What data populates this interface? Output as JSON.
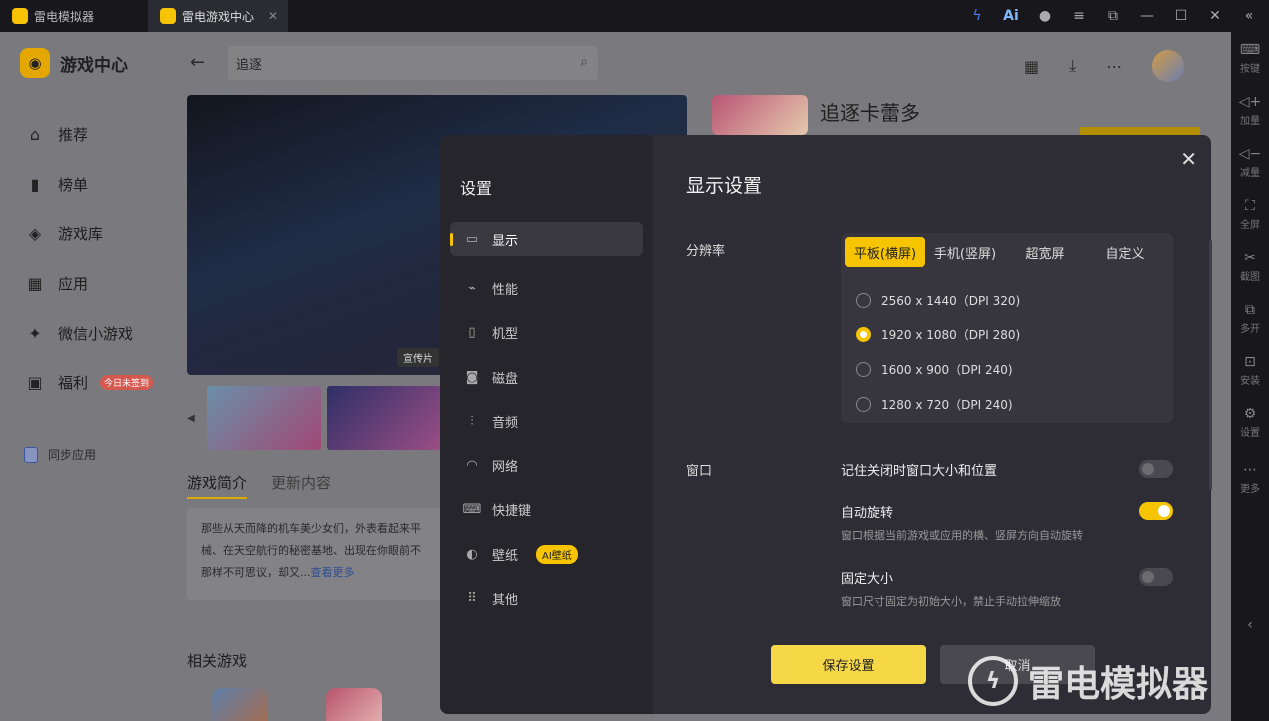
{
  "titlebar": {
    "tabs": [
      {
        "label": "雷电模拟器"
      },
      {
        "label": "雷电游戏中心"
      }
    ],
    "tab_close": "✕",
    "icons": [
      "lightning-icon",
      "ai-icon",
      "avatar-icon",
      "menu-icon",
      "restore-icon",
      "minimize-icon",
      "maximize-icon",
      "close-icon",
      "collapse-icon"
    ],
    "ai_label": "Ai"
  },
  "brand": {
    "title": "游戏中心"
  },
  "nav": [
    {
      "label": "推荐",
      "icon": "home-icon"
    },
    {
      "label": "榜单",
      "icon": "chart-icon"
    },
    {
      "label": "游戏库",
      "icon": "gamepad-icon"
    },
    {
      "label": "应用",
      "icon": "apps-icon"
    },
    {
      "label": "微信小游戏",
      "icon": "wechat-game-icon"
    },
    {
      "label": "福利",
      "icon": "gift-icon",
      "badge": "今日未签到"
    }
  ],
  "sync": {
    "label": "同步应用"
  },
  "search": {
    "value": "追逐"
  },
  "banner": {
    "tag": "宣传片"
  },
  "game_tabs": {
    "intro": "游戏简介",
    "updates": "更新内容"
  },
  "intro": {
    "text_line1": "那些从天而降的机车美少女们，外表看起来平",
    "text_line2": "械、在天空航行的秘密基地、出现在你眼前不",
    "text_line3": "那样不可思议，却又...",
    "more": "查看更多"
  },
  "related": {
    "title": "相关游戏"
  },
  "game": {
    "title": "追逐卡蕾多"
  },
  "rightbar": [
    {
      "label": "按键",
      "icon": "keyboard-icon"
    },
    {
      "label": "加量",
      "icon": "volume-up-icon"
    },
    {
      "label": "减量",
      "icon": "volume-down-icon"
    },
    {
      "label": "全屏",
      "icon": "fullscreen-icon"
    },
    {
      "label": "截图",
      "icon": "scissors-icon"
    },
    {
      "label": "多开",
      "icon": "multi-instance-icon"
    },
    {
      "label": "安装",
      "icon": "install-icon"
    },
    {
      "label": "设置",
      "icon": "settings-icon"
    },
    {
      "label": "更多",
      "icon": "more-icon"
    }
  ],
  "dialog": {
    "title": "设置",
    "menu": [
      {
        "label": "显示",
        "icon": "monitor-icon",
        "active": true
      },
      {
        "label": "性能",
        "icon": "performance-icon"
      },
      {
        "label": "机型",
        "icon": "phone-icon"
      },
      {
        "label": "磁盘",
        "icon": "disk-icon"
      },
      {
        "label": "音频",
        "icon": "audio-icon"
      },
      {
        "label": "网络",
        "icon": "wifi-icon"
      },
      {
        "label": "快捷键",
        "icon": "keyboard-icon"
      },
      {
        "label": "壁纸",
        "icon": "palette-icon",
        "badge": "AI壁纸"
      },
      {
        "label": "其他",
        "icon": "grid-icon"
      }
    ],
    "section_title": "显示设置",
    "resolution": {
      "label": "分辨率",
      "tabs": [
        "平板(横屏)",
        "手机(竖屏)",
        "超宽屏",
        "自定义"
      ],
      "active_tab": 0,
      "options": [
        "2560 x 1440（DPI 320)",
        "1920 x 1080（DPI 280)",
        "1600 x 900（DPI 240)",
        "1280 x 720（DPI 240)"
      ],
      "selected": 1
    },
    "window": {
      "label": "窗口",
      "remember": {
        "title": "记住关闭时窗口大小和位置",
        "on": false
      },
      "auto_rotate": {
        "title": "自动旋转",
        "desc": "窗口根据当前游戏或应用的横、竖屏方向自动旋转",
        "on": true
      },
      "fixed_size": {
        "title": "固定大小",
        "desc": "窗口尺寸固定为初始大小，禁止手动拉伸缩放",
        "on": false
      }
    },
    "save": "保存设置",
    "cancel": "取消"
  },
  "watermark": {
    "text": "雷电模拟器"
  }
}
